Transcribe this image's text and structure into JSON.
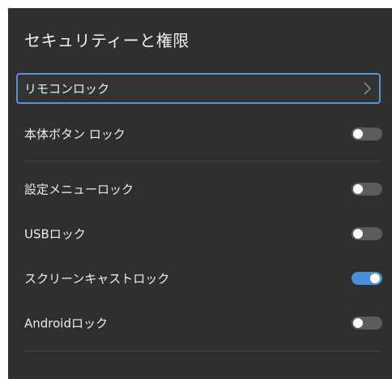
{
  "page": {
    "title": "セキュリティーと権限"
  },
  "items": [
    {
      "label": "リモコンロック",
      "control": "chevron-right-icon",
      "focused": true
    },
    {
      "label": "本体ボタン ロック",
      "control": "toggle",
      "enabled": false
    },
    {
      "label": "設定メニューロック",
      "control": "toggle",
      "enabled": false
    },
    {
      "label": "USBロック",
      "control": "toggle",
      "enabled": false
    },
    {
      "label": "スクリーンキャストロック",
      "control": "toggle",
      "enabled": true
    },
    {
      "label": "Androidロック",
      "control": "toggle",
      "enabled": false
    }
  ],
  "colors": {
    "panel_background": "#2f2f2f",
    "focus_border": "#5b8fd6",
    "toggle_on": "#4a8fd9",
    "toggle_off": "#5c5c5c",
    "text": "#ececec"
  }
}
